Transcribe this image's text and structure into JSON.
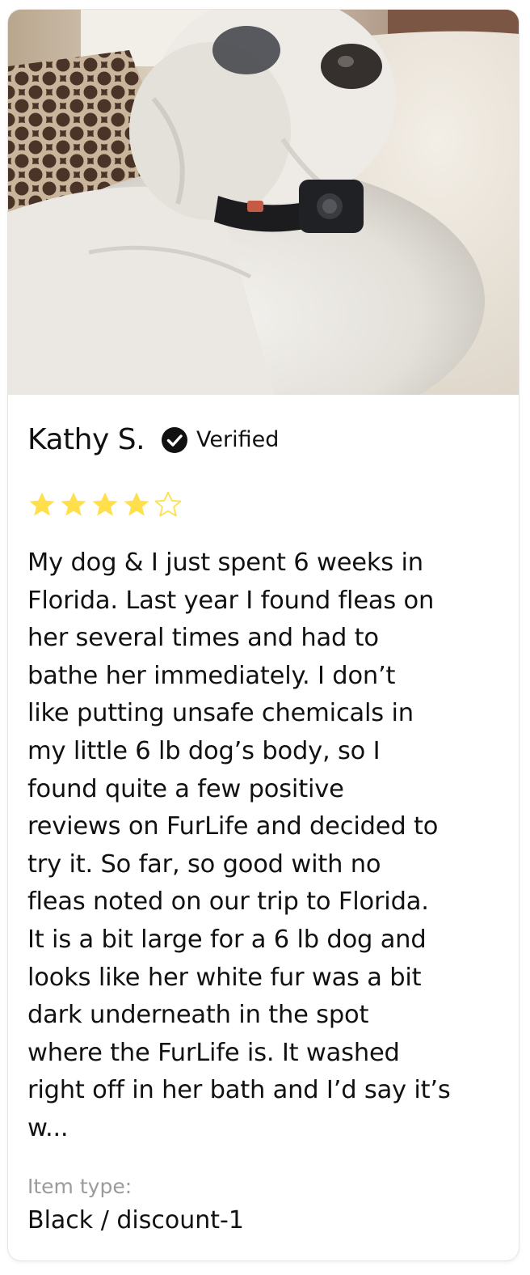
{
  "review": {
    "photo_icon": "dog-photo",
    "reviewer_name": "Kathy S.",
    "verified_label": "Verified",
    "verified_icon": "check-circle-icon",
    "rating": 4,
    "rating_max": 5,
    "star_color": "#FFE04A",
    "text": "My dog & I just spent 6 weeks in\nFlorida.  Last year I found fleas on\nher several times and had to\nbathe her immediately.  I don’t\nlike putting unsafe chemicals in\nmy little 6 lb dog’s body, so I\nfound quite a few positive\nreviews on FurLife and decided to\ntry it.  So far, so good with no\nfleas noted on our trip to Florida.\nIt is a bit large for a 6 lb dog and\nlooks like her white fur was a bit\ndark underneath in the spot\nwhere the FurLife is.  It washed\nright off in her bath and I’d say it’s\nw...",
    "item_type_label": "Item type:",
    "item_type_value": "Black / discount-1"
  }
}
